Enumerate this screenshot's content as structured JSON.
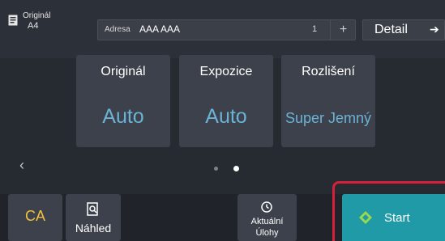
{
  "header": {
    "original_label": "Originál",
    "original_size": "A4",
    "address": {
      "label": "Adresa",
      "value": "AAA AAA",
      "count": "1",
      "plus": "+"
    },
    "detail": {
      "label": "Detail",
      "arrow": "➔"
    }
  },
  "settings": [
    {
      "title": "Originál",
      "value": "Auto"
    },
    {
      "title": "Expozice",
      "value": "Auto"
    },
    {
      "title": "Rozlišení",
      "value": "Super Jemný"
    }
  ],
  "pager": {
    "prev": "‹",
    "current_page": 2,
    "total_pages": 2
  },
  "footer": {
    "ca_label": "CA",
    "preview_label": "Náhled",
    "jobs_label_line1": "Aktuální",
    "jobs_label_line2": "Úlohy",
    "start_label": "Start"
  },
  "colors": {
    "accent_value": "#6bb3d6",
    "ca": "#f0c23b",
    "start_bg": "#1f9aa6",
    "highlight": "#d8203a"
  },
  "icons": {
    "original": "document-icon",
    "preview": "preview-icon",
    "jobs": "jobs-status-icon",
    "start": "start-diamond-icon"
  }
}
